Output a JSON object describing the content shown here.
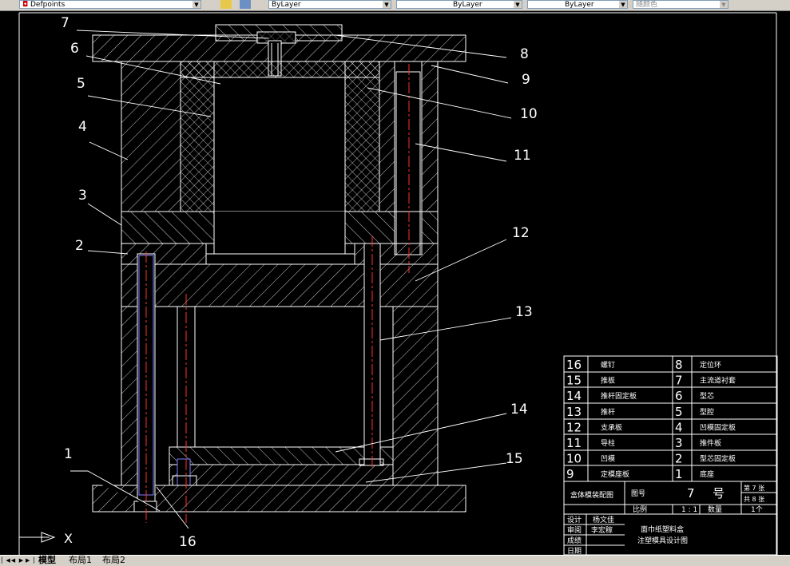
{
  "toolbar": {
    "layer_name": "Defpoints",
    "linetype1": "ByLayer",
    "linetype2": "ByLayer",
    "lineweight": "ByLayer",
    "plotstyle": "随颜色"
  },
  "callouts": [
    "1",
    "2",
    "3",
    "4",
    "5",
    "6",
    "7",
    "8",
    "9",
    "10",
    "11",
    "12",
    "13",
    "14",
    "15",
    "16"
  ],
  "ucs_label": "X",
  "parts_list": [
    {
      "no_left": "16",
      "name_left": "螺钉",
      "no_right": "8",
      "name_right": "定位环"
    },
    {
      "no_left": "15",
      "name_left": "推板",
      "no_right": "7",
      "name_right": "主流道衬套"
    },
    {
      "no_left": "14",
      "name_left": "推杆固定板",
      "no_right": "6",
      "name_right": "型芯"
    },
    {
      "no_left": "13",
      "name_left": "推杆",
      "no_right": "5",
      "name_right": "型腔"
    },
    {
      "no_left": "12",
      "name_left": "支承板",
      "no_right": "4",
      "name_right": "凹模固定板"
    },
    {
      "no_left": "11",
      "name_left": "导柱",
      "no_right": "3",
      "name_right": "推件板"
    },
    {
      "no_left": "10",
      "name_left": "凹模",
      "no_right": "2",
      "name_right": "型芯固定板"
    },
    {
      "no_left": "9",
      "name_left": "定模座板",
      "no_right": "1",
      "name_right": "底座"
    }
  ],
  "title_block": {
    "drawing_name": "盒体模装配图",
    "fig_no_label": "图号",
    "fig_no_value": "7",
    "fig_no_unit": "号",
    "sheet_no": "第 7 张",
    "sheet_total": "共 8 张",
    "scale_label": "比例",
    "scale_value": "1 : 1",
    "qty_label": "数量",
    "qty_value": "1个",
    "design_label": "设计",
    "designer": "杨文佳",
    "review_label": "审阅",
    "reviewer": "李宏稼",
    "grade_label": "成绩",
    "date_label": "日期",
    "project_title_1": "面巾纸塑料盒",
    "project_title_2": "注塑模具设计图"
  },
  "tabs": {
    "model": "模型",
    "layout1": "布局1",
    "layout2": "布局2"
  }
}
